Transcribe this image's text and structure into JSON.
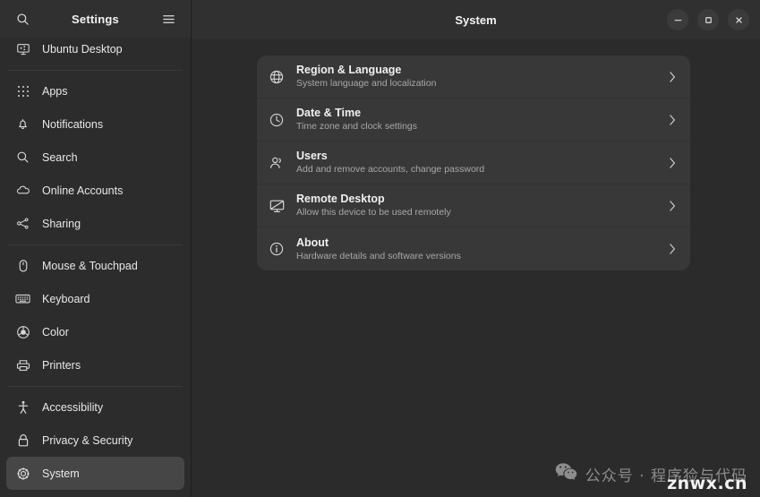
{
  "window": {
    "title": "System",
    "controls": [
      {
        "name": "minimize",
        "glyph": "–"
      },
      {
        "name": "maximize",
        "glyph": "□"
      },
      {
        "name": "close",
        "glyph": "✕"
      }
    ]
  },
  "sidebar": {
    "title": "Settings",
    "search_icon": "search-icon",
    "menu_icon": "hamburger-menu-icon",
    "groups": [
      {
        "items": [
          {
            "label": "Ubuntu Desktop",
            "icon": "ubuntu-desktop-icon",
            "selected": false
          }
        ]
      },
      {
        "items": [
          {
            "label": "Apps",
            "icon": "apps-grid-icon",
            "selected": false
          },
          {
            "label": "Notifications",
            "icon": "bell-icon",
            "selected": false
          },
          {
            "label": "Search",
            "icon": "search-icon",
            "selected": false
          },
          {
            "label": "Online Accounts",
            "icon": "cloud-icon",
            "selected": false
          },
          {
            "label": "Sharing",
            "icon": "share-nodes-icon",
            "selected": false
          }
        ]
      },
      {
        "items": [
          {
            "label": "Mouse & Touchpad",
            "icon": "mouse-icon",
            "selected": false
          },
          {
            "label": "Keyboard",
            "icon": "keyboard-icon",
            "selected": false
          },
          {
            "label": "Color",
            "icon": "color-wheel-icon",
            "selected": false
          },
          {
            "label": "Printers",
            "icon": "printer-icon",
            "selected": false
          }
        ]
      },
      {
        "items": [
          {
            "label": "Accessibility",
            "icon": "accessibility-person-icon",
            "selected": false
          },
          {
            "label": "Privacy & Security",
            "icon": "lock-icon",
            "selected": false
          },
          {
            "label": "System",
            "icon": "gear-icon",
            "selected": true
          }
        ]
      }
    ]
  },
  "main": {
    "rows": [
      {
        "title": "Region & Language",
        "subtitle": "System language and localization",
        "icon": "globe-icon",
        "chevron": "chevron-right-icon"
      },
      {
        "title": "Date & Time",
        "subtitle": "Time zone and clock settings",
        "icon": "clock-icon",
        "chevron": "chevron-right-icon"
      },
      {
        "title": "Users",
        "subtitle": "Add and remove accounts, change password",
        "icon": "users-icon",
        "chevron": "chevron-right-icon"
      },
      {
        "title": "Remote Desktop",
        "subtitle": "Allow this device to be used remotely",
        "icon": "remote-desktop-icon",
        "chevron": "chevron-right-icon"
      },
      {
        "title": "About",
        "subtitle": "Hardware details and software versions",
        "icon": "info-icon",
        "chevron": "chevron-right-icon"
      }
    ]
  },
  "watermark": {
    "text": "公众号 · 程序猃与代码",
    "icon": "wechat-icon",
    "overlay_text": "znwx.cn"
  },
  "colors": {
    "window_bg": "#2b2b2b",
    "sidebar_bg": "#2c2c2c",
    "header_bg": "#303030",
    "card_bg": "#383838",
    "selected_bg": "#464646",
    "text_primary": "#f0f0f0",
    "text_secondary": "#a8a8a8"
  }
}
